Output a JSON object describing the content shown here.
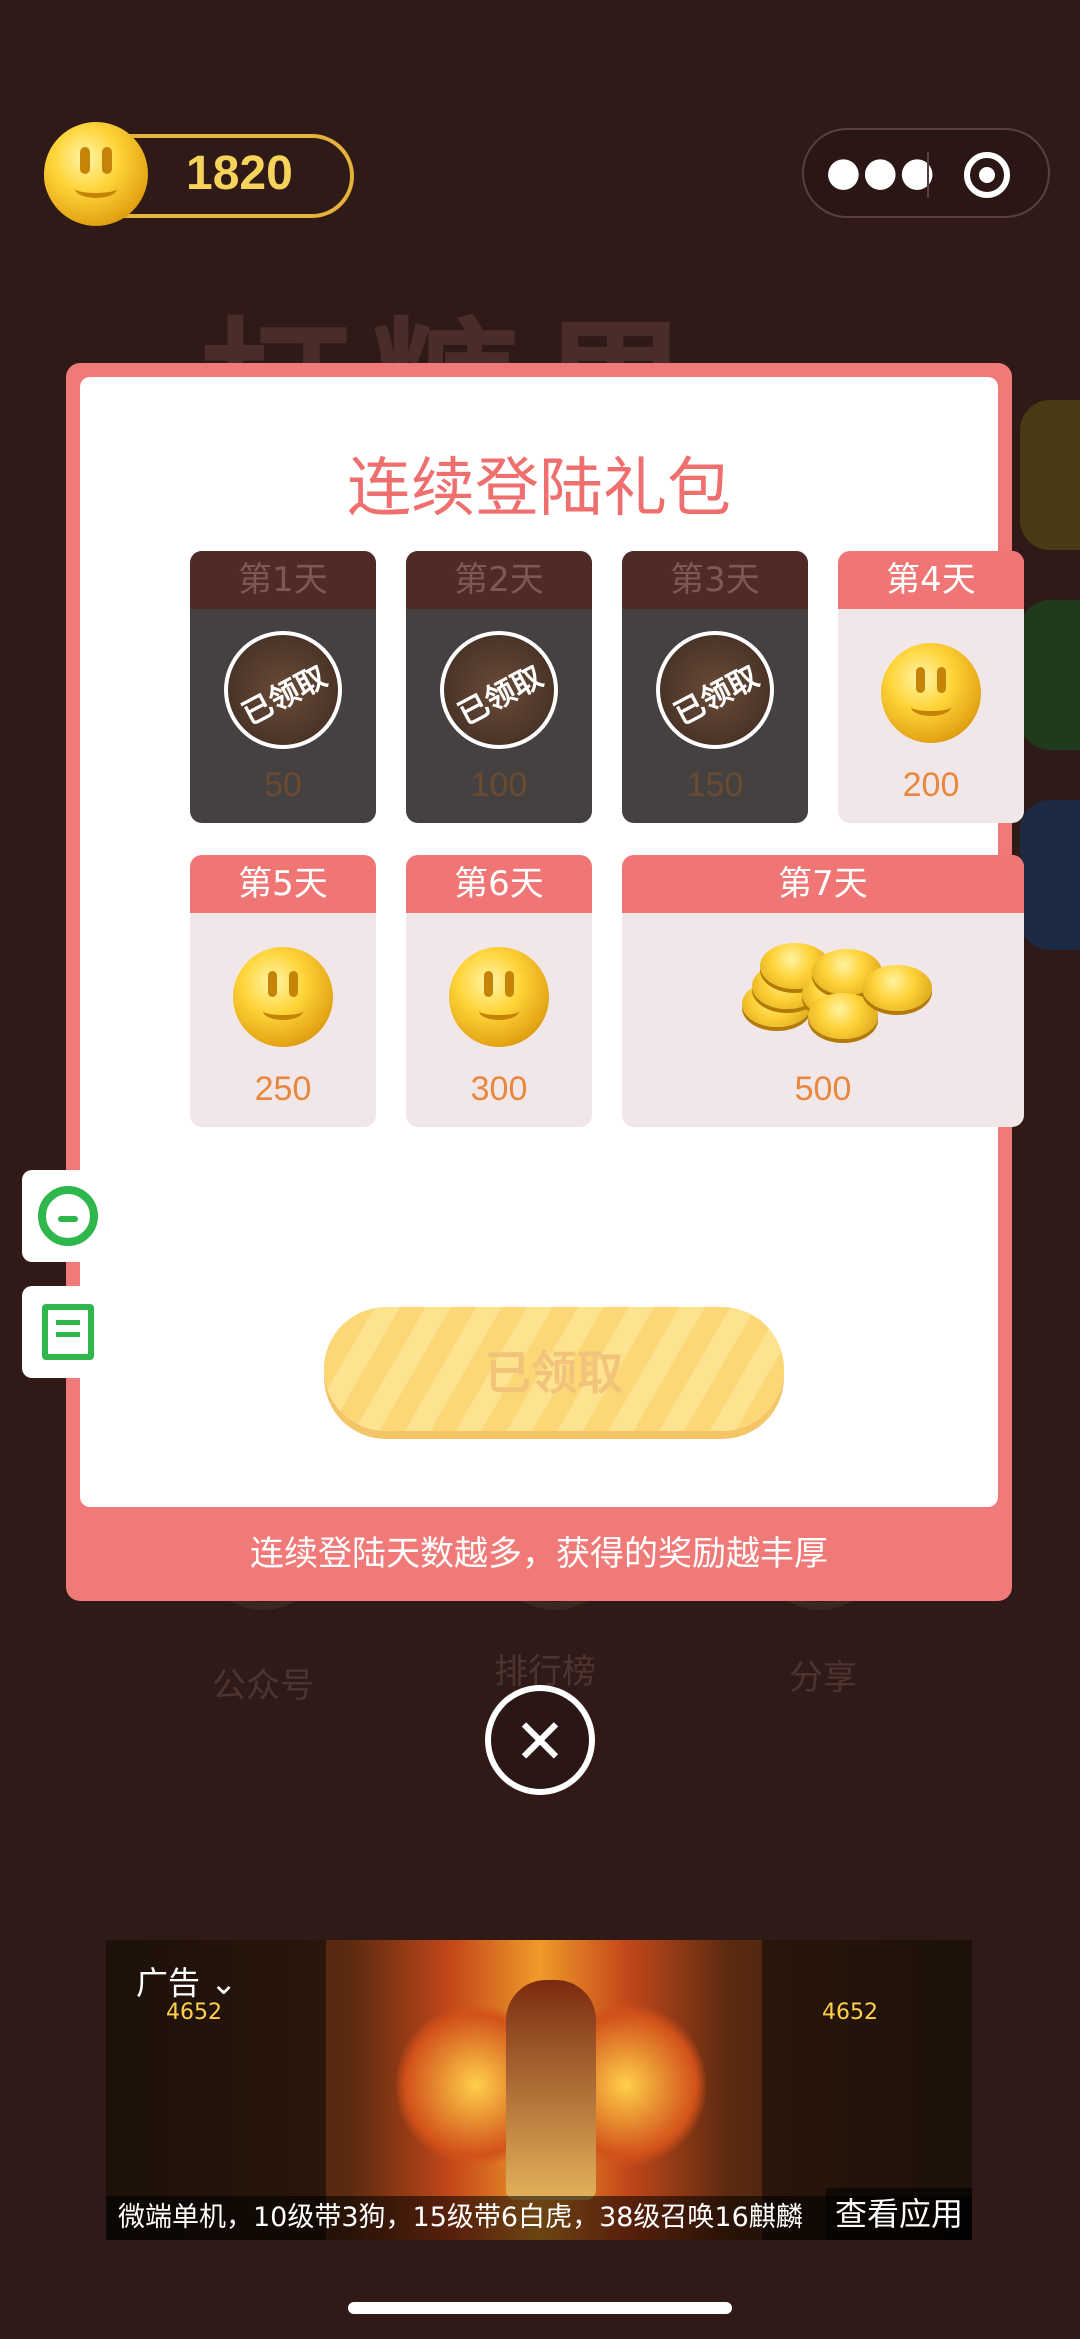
{
  "top_bar": {
    "coin_balance": "1820"
  },
  "modal": {
    "title": "连续登陆礼包",
    "days": [
      {
        "label": "第1天",
        "amount": "50",
        "claimed": true,
        "stamp": "已领取"
      },
      {
        "label": "第2天",
        "amount": "100",
        "claimed": true,
        "stamp": "已领取"
      },
      {
        "label": "第3天",
        "amount": "150",
        "claimed": true,
        "stamp": "已领取"
      },
      {
        "label": "第4天",
        "amount": "200",
        "claimed": false
      },
      {
        "label": "第5天",
        "amount": "250",
        "claimed": false
      },
      {
        "label": "第6天",
        "amount": "300",
        "claimed": false
      },
      {
        "label": "第7天",
        "amount": "500",
        "claimed": false
      }
    ],
    "claim_button": "已领取",
    "footer": "连续登陆天数越多，获得的奖励越丰厚"
  },
  "background_menu": [
    "公众号",
    "排行榜",
    "分享"
  ],
  "ad": {
    "label": "广告",
    "caption": "微端单机，10级带3狗，15级带6白虎，38级召唤16麒麟",
    "cta": "查看应用",
    "badge_number": "4652"
  },
  "colors": {
    "accent": "#ef7674",
    "coin": "#ffd338",
    "background": "#2f1a18"
  }
}
